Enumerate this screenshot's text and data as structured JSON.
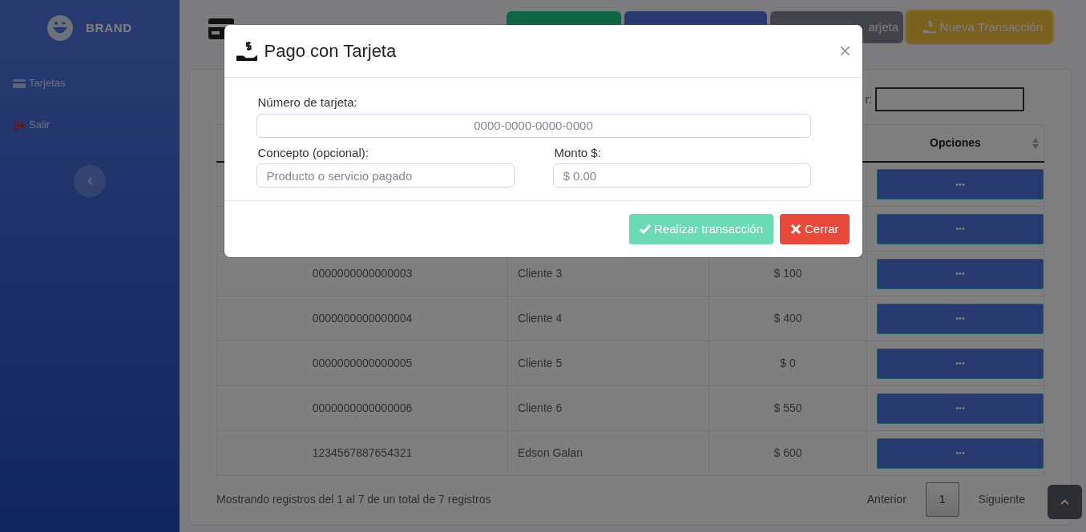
{
  "sidebar": {
    "brand": "BRAND",
    "items": [
      {
        "label": "Tarjetas",
        "kind": "card"
      },
      {
        "label": "Salir",
        "kind": "logout"
      }
    ]
  },
  "header": {
    "buttons": [
      {
        "kind": "success"
      },
      {
        "kind": "primary"
      },
      {
        "kind": "secondary",
        "label": "arjeta"
      },
      {
        "kind": "warning",
        "label": "Nueva Transacción"
      }
    ]
  },
  "table": {
    "options_column": "Opciones",
    "search_label": "r:",
    "rows": [
      {
        "options": "•••"
      },
      {
        "options": "•••"
      },
      {
        "card": "0000000000000003",
        "client": "Cliente 3",
        "balance": "$ 100",
        "options": "•••"
      },
      {
        "card": "0000000000000004",
        "client": "Cliente 4",
        "balance": "$ 400",
        "options": "•••"
      },
      {
        "card": "0000000000000005",
        "client": "Cliente 5",
        "balance": "$ 0",
        "options": "•••"
      },
      {
        "card": "0000000000000006",
        "client": "Cliente 6",
        "balance": "$ 550",
        "options": "•••"
      },
      {
        "card": "1234567887654321",
        "client": "Edson Galan",
        "balance": "$ 600",
        "options": "•••"
      }
    ],
    "info": "Mostrando registros del 1 al 7 de un total de 7 registros",
    "pagination": {
      "previous": "Anterior",
      "pages": [
        {
          "label": "1",
          "selected": true
        }
      ],
      "next": "Siguiente"
    }
  },
  "modal": {
    "title": "Pago con Tarjeta",
    "fields": [
      {
        "label": "Número de tarjeta:",
        "placeholder": "0000-0000-0000-0000"
      },
      {
        "label": "Concepto (opcional):",
        "placeholder": "Producto o servicio pagado"
      },
      {
        "label": "Monto $:",
        "placeholder": "$ 0.00"
      }
    ],
    "buttons": [
      {
        "kind": "submit",
        "label": "Realizar transacción",
        "disabled": true
      },
      {
        "kind": "close",
        "label": "Cerrar",
        "disabled": false
      }
    ]
  }
}
